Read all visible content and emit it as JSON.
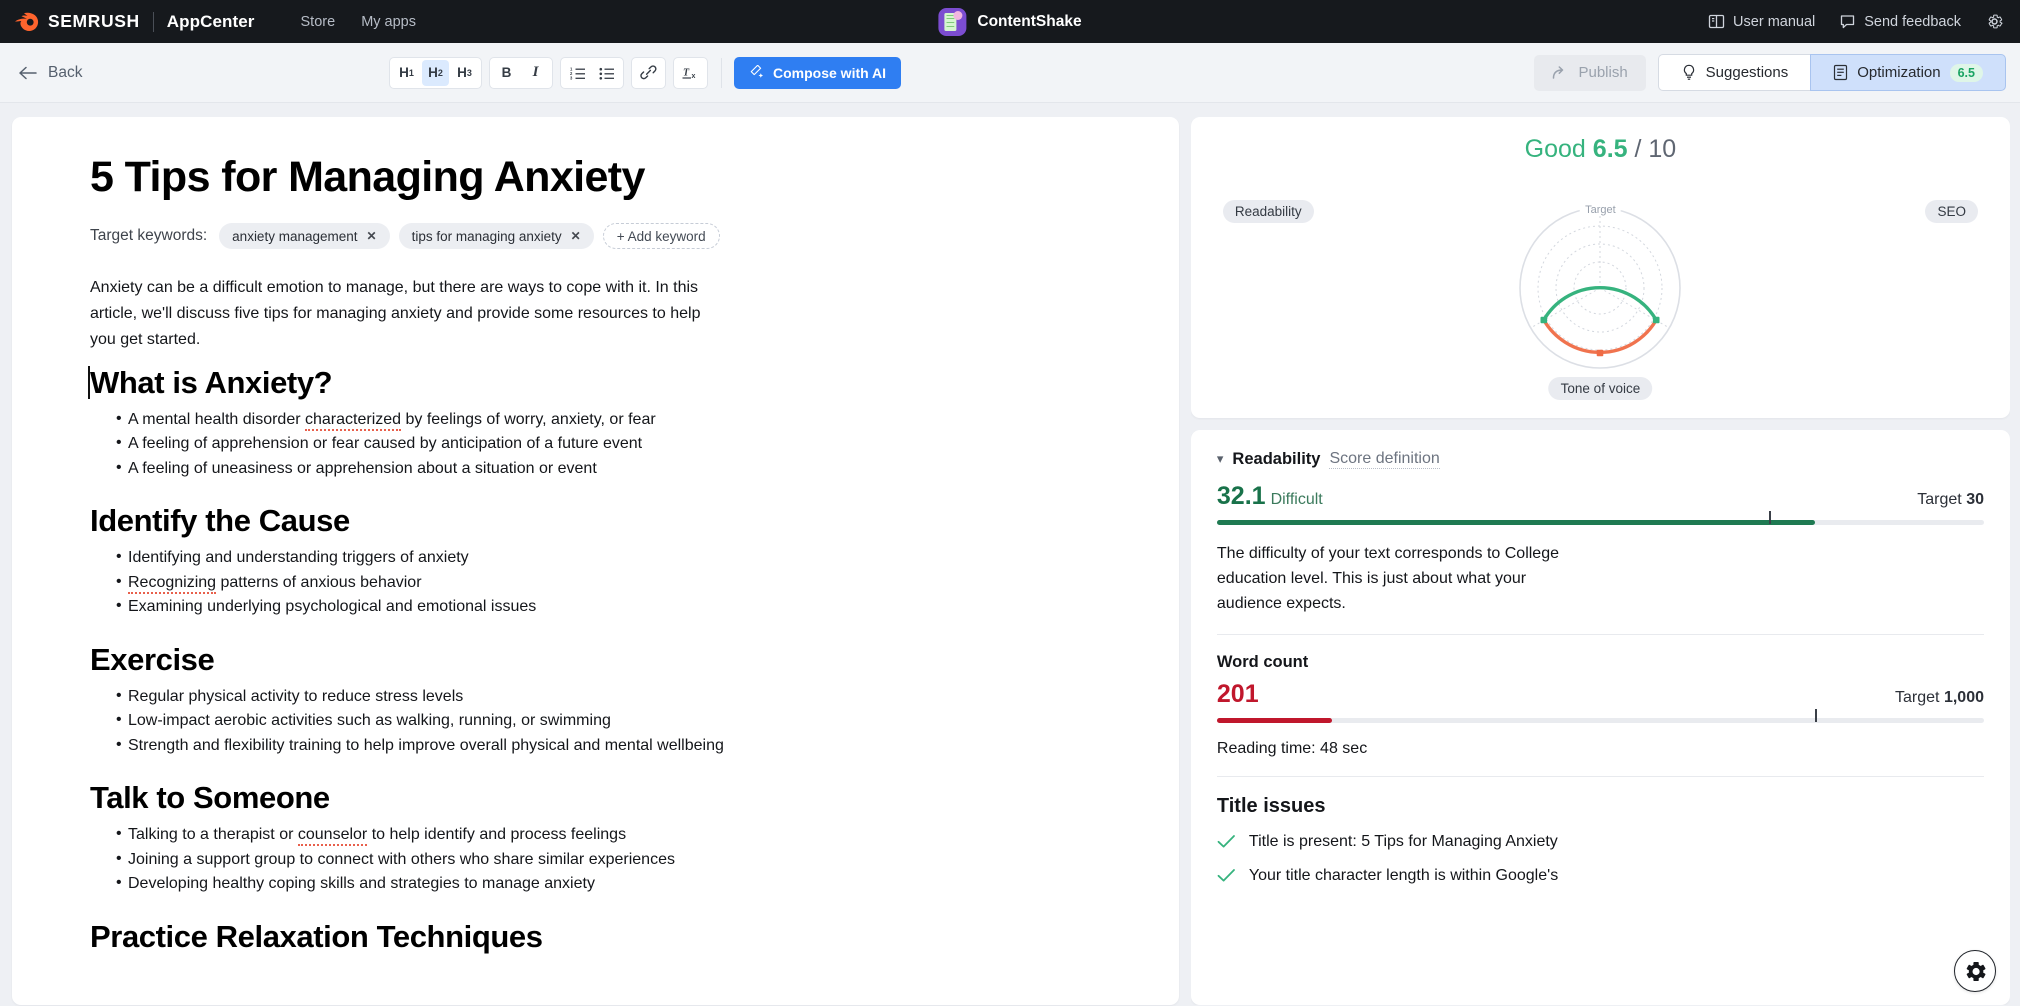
{
  "topbar": {
    "brand": "SEMRUSH",
    "product": "AppCenter",
    "nav": [
      {
        "label": "Store"
      },
      {
        "label": "My apps"
      }
    ],
    "app_title": "ContentShake",
    "app_icon": "contentshake-logo-icon",
    "right_items": [
      {
        "label": "User manual",
        "icon": "book-icon"
      },
      {
        "label": "Send feedback",
        "icon": "comment-icon"
      }
    ],
    "settings_icon": "gear-icon",
    "background": "#16191d"
  },
  "toolbar": {
    "back_label": "Back",
    "headings": [
      {
        "label": "H",
        "sub": "1",
        "active": false
      },
      {
        "label": "H",
        "sub": "2",
        "active": true
      },
      {
        "label": "H",
        "sub": "3",
        "active": false
      }
    ],
    "bold_label": "B",
    "italic_label": "I",
    "ordered_list_icon": "ordered-list-icon",
    "bullet_list_icon": "bullet-list-icon",
    "link_icon": "link-icon",
    "clear_format_icon": "clear-formatting-icon",
    "compose_label": "Compose with AI",
    "compose_color": "#2f7ef2",
    "publish_label": "Publish",
    "tabs": [
      {
        "label": "Suggestions",
        "icon": "lightbulb-icon",
        "selected": false
      },
      {
        "label": "Optimization",
        "icon": "document-icon",
        "selected": true,
        "score": "6.5"
      }
    ]
  },
  "document": {
    "title": "5 Tips for Managing Anxiety",
    "keywords_label": "Target keywords:",
    "keywords": [
      {
        "text": "anxiety management"
      },
      {
        "text": "tips for managing anxiety"
      }
    ],
    "add_keyword_label": "+ Add keyword",
    "intro": "Anxiety can be a difficult emotion to manage, but there are ways to cope with it. In this article, we'll discuss five tips for managing anxiety and provide some resources to help you get started.",
    "sections": [
      {
        "heading": "What is Anxiety?",
        "items": [
          {
            "pre": "A mental health disorder ",
            "flag": "characterized",
            "post": " by feelings of worry, anxiety, or fear"
          },
          {
            "pre": "A feeling of apprehension or fear caused by anticipation of a future event",
            "flag": "",
            "post": ""
          },
          {
            "pre": "A feeling of uneasiness or apprehension about a situation or event",
            "flag": "",
            "post": ""
          }
        ]
      },
      {
        "heading": "Identify the Cause",
        "items": [
          {
            "pre": "Identifying and understanding triggers of anxiety",
            "flag": "",
            "post": ""
          },
          {
            "pre": "",
            "flag": "Recognizing",
            "post": " patterns of anxious behavior"
          },
          {
            "pre": "Examining underlying psychological and emotional issues",
            "flag": "",
            "post": ""
          }
        ]
      },
      {
        "heading": "Exercise",
        "items": [
          {
            "pre": "Regular physical activity to reduce stress levels",
            "flag": "",
            "post": ""
          },
          {
            "pre": "Low-impact aerobic activities such as walking, running, or swimming",
            "flag": "",
            "post": ""
          },
          {
            "pre": "Strength and flexibility training to help improve overall physical and mental wellbeing",
            "flag": "",
            "post": ""
          }
        ]
      },
      {
        "heading": "Talk to Someone",
        "items": [
          {
            "pre": "Talking to a therapist or ",
            "flag": "counselor",
            "post": " to help identify and process feelings"
          },
          {
            "pre": "Joining a support group to connect with others who share similar experiences",
            "flag": "",
            "post": ""
          },
          {
            "pre": "Developing healthy coping skills and strategies to manage anxiety",
            "flag": "",
            "post": ""
          }
        ]
      },
      {
        "heading": "Practice Relaxation Techniques",
        "items": []
      }
    ]
  },
  "optimization": {
    "score_word": "Good",
    "score_value": "6.5",
    "score_max": "/ 10",
    "gauge": {
      "target_label": "Target",
      "axes": [
        {
          "label": "Readability",
          "position": "left",
          "color": "#36b37e"
        },
        {
          "label": "SEO",
          "position": "right",
          "color": "#36b37e"
        },
        {
          "label": "Tone of voice",
          "position": "bottom",
          "color": "#ef6b45"
        }
      ]
    },
    "readability": {
      "section_title": "Readability",
      "score_definition_label": "Score definition",
      "value": "32.1",
      "qualifier": "Difficult",
      "target_prefix": "Target",
      "target_value": "30",
      "bar_fill_percent": 78,
      "bar_tick_percent": 72,
      "bar_color": "#1f7a52",
      "description": "The difficulty of your text corresponds to College education level. This is just about what your audience expects."
    },
    "word_count": {
      "title": "Word count",
      "value": "201",
      "target_prefix": "Target",
      "target_value": "1,000",
      "bar_fill_percent": 15,
      "bar_tick_percent": 78,
      "bar_color": "#c0172c",
      "reading_time": "Reading time: 48 sec"
    },
    "title_issues": {
      "title": "Title issues",
      "items": [
        {
          "text": "Title is present: 5 Tips for Managing Anxiety",
          "status": "ok"
        },
        {
          "text": "Your title character length is within Google's",
          "status": "ok"
        }
      ]
    }
  },
  "fab": {
    "icon": "gear-icon"
  }
}
